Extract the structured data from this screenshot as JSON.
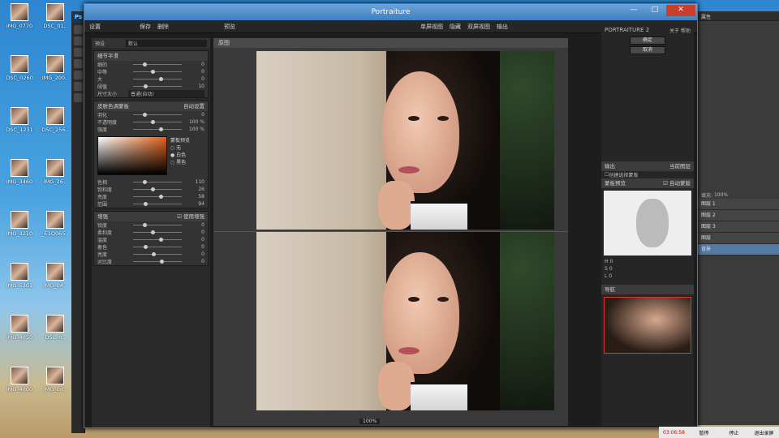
{
  "desktop": {
    "icons": [
      "IMG_0770",
      "DSC_01..",
      "DSC_0260",
      "IMG_200..",
      "DSC_1231",
      "DSC_256..",
      "IMG_3460",
      "IMG_26..",
      "IMG_3210",
      "_E1Q065..",
      "IMG_5301",
      "IMG_04..",
      "IMG_4050",
      "DSC_0..",
      "IMG_4000",
      "IMG_0d.."
    ]
  },
  "ps": {
    "logo": "Ps",
    "tab": "属性",
    "zoom": "100%",
    "fill_label": "填充:",
    "fill_value": "100%",
    "layers": [
      "图层 1",
      "图层 2",
      "图层 3",
      "图层",
      "背景"
    ]
  },
  "window": {
    "title": "Portraiture",
    "min": "—",
    "max": "□",
    "close": "✕"
  },
  "topbar": {
    "left_a": "设置",
    "left_b": "保存",
    "left_c": "删除",
    "preview_label": "预览",
    "opt1": "单屏视图",
    "opt2": "隐藏",
    "opt3": "双屏视图",
    "opt4": "输出"
  },
  "left": {
    "preset_label": "预设",
    "preset_value": "默认",
    "s1": {
      "title": "细节平滑",
      "rows": [
        [
          "细的",
          "0"
        ],
        [
          "中等",
          "0"
        ],
        [
          "大",
          "0"
        ],
        [
          "阈值",
          "10"
        ]
      ],
      "size_label": "尺寸大小",
      "size_value": "普通(自动)"
    },
    "s2": {
      "title": "皮肤色调蒙板",
      "mode": "自动设置",
      "rows": [
        [
          "羽化",
          "0"
        ],
        [
          "不透明度",
          "100 %"
        ],
        [
          "强度",
          "100 %"
        ]
      ],
      "view_title": "蒙板预览",
      "views": [
        "无",
        "白色",
        "黑色"
      ],
      "rows2": [
        [
          "色相",
          "110"
        ],
        [
          "饱和度",
          "26"
        ],
        [
          "亮度",
          "58"
        ],
        [
          "范围",
          "94"
        ]
      ]
    },
    "s3": {
      "title": "增强",
      "enable": "使用增强",
      "rows": [
        [
          "锐度",
          "0"
        ],
        [
          "柔和度",
          "0"
        ],
        [
          "温度",
          "0"
        ],
        [
          "着色",
          "0"
        ],
        [
          "亮度",
          "0"
        ],
        [
          "对比度",
          "0"
        ]
      ]
    }
  },
  "preview": {
    "tab": "原图",
    "zoom": "100%"
  },
  "right": {
    "brand": "PORTRAITURE 2",
    "about": "关于",
    "help": "帮助",
    "ok": "确定",
    "cancel": "取消",
    "output_label": "输出",
    "output_value": "当前图层",
    "output_check": "创建选择蒙版",
    "mask_title": "蒙板预览",
    "auto_mask": "自动蒙版",
    "hsl": [
      [
        "H",
        "0"
      ],
      [
        "S",
        "0"
      ],
      [
        "L",
        "0"
      ]
    ],
    "nav": "导航"
  },
  "taskbar": {
    "time": "03:06:58",
    "b1": "暂停",
    "b2": "停止",
    "b3": "退出录屏"
  }
}
